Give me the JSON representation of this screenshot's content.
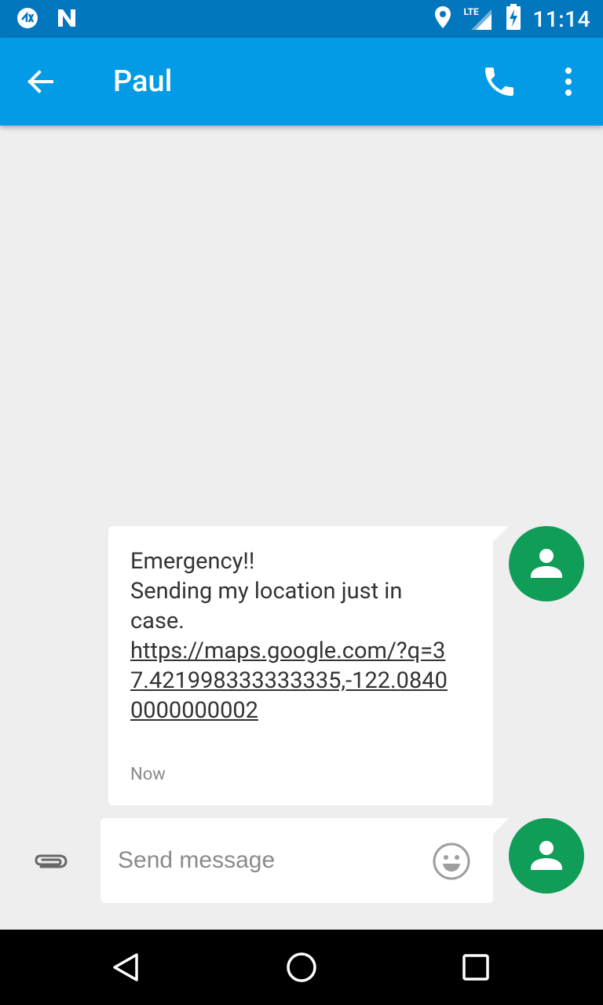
{
  "status_bar": {
    "time": "11:14",
    "network": "LTE",
    "left_icons": [
      "notification-badge-icon",
      "n-logo-icon"
    ],
    "right_icons": [
      "location-icon",
      "signal-icon",
      "battery-charging-icon"
    ]
  },
  "app_bar": {
    "title": "Paul",
    "color": "#039be5",
    "icons": [
      "back-arrow-icon",
      "phone-icon",
      "more-vert-icon"
    ]
  },
  "conversation": {
    "messages": [
      {
        "lines": [
          "Emergency!!",
          "Sending my location just in case."
        ],
        "link": "https://maps.google.com/?q=37.421998333333335,-122.08400000000002",
        "timestamp": "Now"
      }
    ]
  },
  "compose": {
    "placeholder": "Send message",
    "icons": [
      "paperclip-icon",
      "emoji-icon"
    ]
  },
  "avatar_color": "#0f9d58",
  "nav_bar": {
    "icons": [
      "nav-back-icon",
      "nav-home-icon",
      "nav-recents-icon"
    ]
  }
}
